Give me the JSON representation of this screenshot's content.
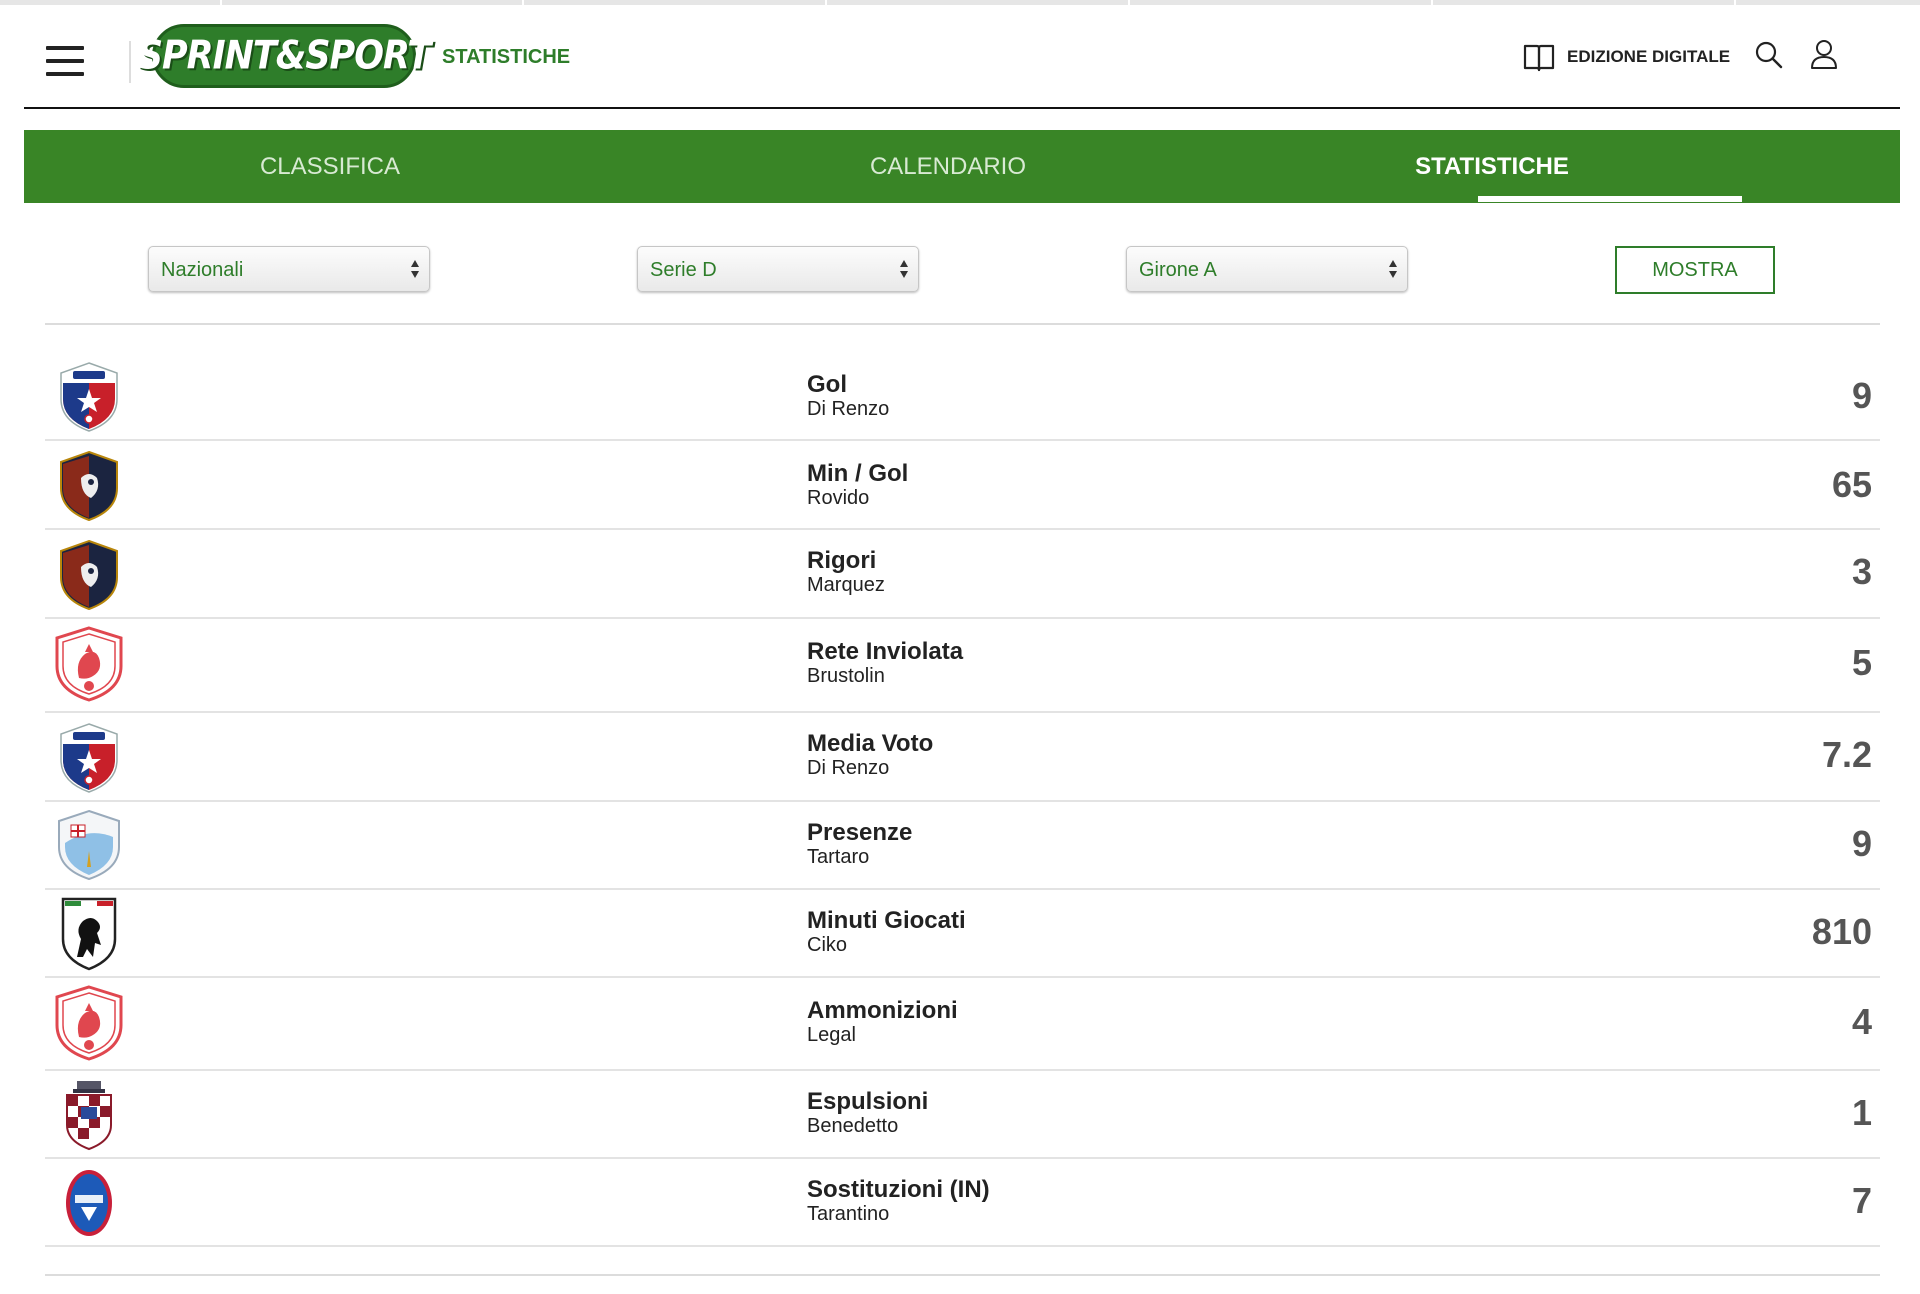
{
  "header": {
    "logo_text": "SPRINT&SPORT",
    "section_label": "STATISTICHE",
    "edizione_label": "EDIZIONE DIGITALE",
    "icons": [
      "hamburger-menu-icon",
      "book-icon",
      "search-icon",
      "user-icon"
    ]
  },
  "tabs": [
    {
      "label": "CLASSIFICA",
      "active": false
    },
    {
      "label": "CALENDARIO",
      "active": false
    },
    {
      "label": "STATISTICHE",
      "active": true
    }
  ],
  "filters": {
    "category": "Nazionali",
    "league": "Serie D",
    "group": "Girone A",
    "submit_label": "MOSTRA"
  },
  "stats": [
    {
      "stat": "Gol",
      "player": "Di Renzo",
      "value": "9",
      "crest": "vado"
    },
    {
      "stat": "Min / Gol",
      "player": "Rovido",
      "value": "65",
      "crest": "sestri-levante"
    },
    {
      "stat": "Rigori",
      "player": "Marquez",
      "value": "3",
      "crest": "sestri-levante"
    },
    {
      "stat": "Rete Inviolata",
      "player": "Brustolin",
      "value": "5",
      "crest": "asti"
    },
    {
      "stat": "Media Voto",
      "player": "Di Renzo",
      "value": "7.2",
      "crest": "vado"
    },
    {
      "stat": "Presenze",
      "player": "Tartaro",
      "value": "9",
      "crest": "lightblue-shield"
    },
    {
      "stat": "Minuti Giocati",
      "player": "Ciko",
      "value": "810",
      "crest": "black-lion"
    },
    {
      "stat": "Ammonizioni",
      "player": "Legal",
      "value": "4",
      "crest": "asti"
    },
    {
      "stat": "Espulsioni",
      "player": "Benedetto",
      "value": "1",
      "crest": "checkered-crown"
    },
    {
      "stat": "Sostituzioni (IN)",
      "player": "Tarantino",
      "value": "7",
      "crest": "fossano"
    }
  ],
  "colors": {
    "brand_green": "#2e7d2a",
    "tab_bar_green": "#398526",
    "value_grey": "#555555"
  }
}
